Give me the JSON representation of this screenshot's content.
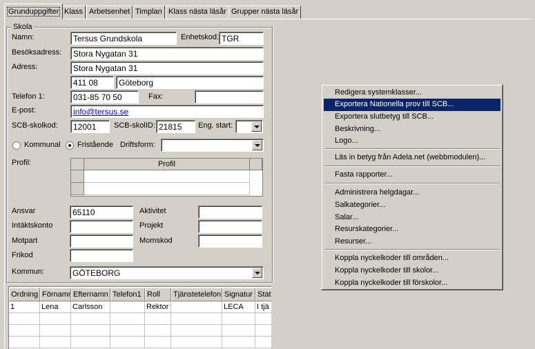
{
  "tabs": [
    {
      "label": "Grunduppgifter",
      "active": true
    },
    {
      "label": "Klass"
    },
    {
      "label": "Arbetsenhet"
    },
    {
      "label": "Timplan"
    },
    {
      "label": "Klass nästa läsår"
    },
    {
      "label": "Grupper nästa läsår"
    }
  ],
  "school": {
    "group_title": "Skola",
    "name_label": "Namn:",
    "name": "Tersus Grundskola",
    "unit_code_label": "Enhetskod:",
    "unit_code": "TGR",
    "visit_address_label": "Besöksadress:",
    "visit_address": "Stora Nygatan 31",
    "address_label": "Adress:",
    "address": "Stora Nygatan 31",
    "postal_code": "411 08",
    "city": "Göteborg",
    "phone_label": "Telefon 1:",
    "phone": "031-85 70 50",
    "fax_label": "Fax:",
    "fax": "",
    "email_label": "E-post:",
    "email": "info@tersus.se",
    "scb_code_label": "SCB-skolkod:",
    "scb_code": "12001",
    "scb_id_label": "SCB-skolID:",
    "scb_id": "21815",
    "eng_start_label": "Eng. start:",
    "eng_start": "",
    "radio_municipal": "Kommunal",
    "radio_independent": "Fristående",
    "operation_form_label": "Driftsform:",
    "operation_form": "",
    "profile_label": "Profil:",
    "profile_header": "Profil",
    "responsible_label": "Ansvar",
    "responsible": "65110",
    "activity_label": "Aktivitet",
    "activity": "",
    "income_account_label": "Intäktskonto",
    "income_account": "",
    "project_label": "Projekt",
    "project": "",
    "counterpart_label": "Motpart",
    "counterpart": "",
    "vat_code_label": "Momskod",
    "vat_code": "",
    "free_code_label": "Frikod",
    "free_code": "",
    "municipality_label": "Kommun:",
    "municipality": "GÖTEBORG"
  },
  "staff_table": {
    "columns": [
      "Ordning",
      "Förnamn",
      "Efternamn",
      "Telefon1",
      "Roll",
      "Tjänstetelefon",
      "Signatur",
      "Stat"
    ],
    "rows": [
      [
        "1",
        "Lena",
        "Carlsson",
        "",
        "Rektor",
        "",
        "LECA",
        "I tjä"
      ]
    ]
  },
  "context_menu": {
    "items": [
      "Redigera systemklasser...",
      "Exportera Nationella prov till SCB...",
      "Exportera slutbetyg till SCB...",
      "Beskrivning...",
      "Logo...",
      "Läs in betyg från Adela.net (webbmodulen)...",
      "Fasta rapporter...",
      "Administrera helgdagar...",
      "Salkategorier...",
      "Salar...",
      "Resurskategorier...",
      "Resurser...",
      "Koppla nyckelkoder till områden...",
      "Koppla nyckelkoder till skolor...",
      "Koppla nyckelkoder till förskolor..."
    ],
    "highlighted_index": 1,
    "highlight_color": "#0a246a"
  }
}
